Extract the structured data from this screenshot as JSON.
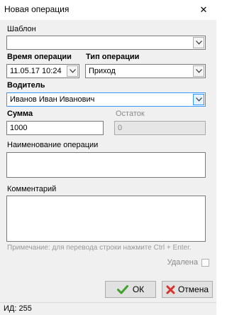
{
  "window": {
    "title": "Новая операция",
    "close_glyph": "✕"
  },
  "template": {
    "label": "Шаблон",
    "value": ""
  },
  "time": {
    "label": "Время операции",
    "value": "11.05.17 10:24"
  },
  "op_type": {
    "label": "Тип операции",
    "value": "Приход"
  },
  "driver": {
    "label": "Водитель",
    "value": "Иванов Иван Иванович"
  },
  "amount": {
    "label": "Сумма",
    "value": "1000"
  },
  "balance": {
    "label": "Остаток",
    "value": "0"
  },
  "op_name": {
    "label": "Наименование операции",
    "value": ""
  },
  "comment": {
    "label": "Комментарий",
    "value": ""
  },
  "hint": "Примечание: для перевода строки нажмите Ctrl + Enter.",
  "deleted": {
    "label": "Удалена",
    "checked": false
  },
  "buttons": {
    "ok": "ОК",
    "cancel": "Отмена"
  },
  "status": {
    "id_text": "ИД: 255"
  },
  "colors": {
    "ok_icon": "#3fa12b",
    "cancel_icon": "#d8322b",
    "focus_border": "#3399ff"
  }
}
